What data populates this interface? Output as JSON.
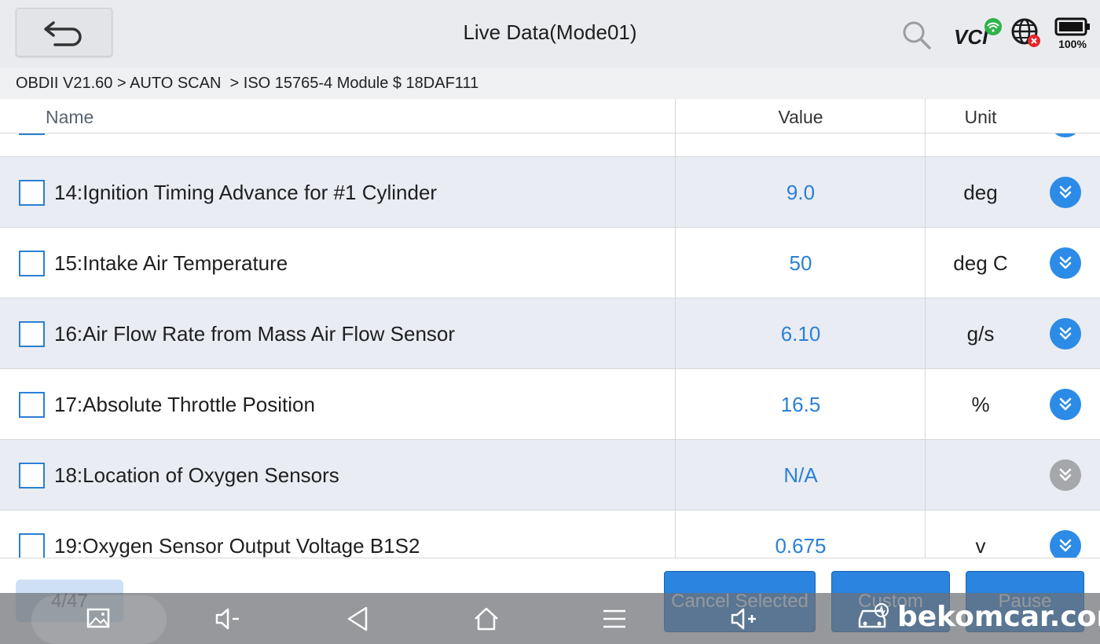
{
  "header": {
    "title": "Live Data(Mode01)",
    "battery_label": "100%",
    "vci_label": "VCI"
  },
  "breadcrumb": "OBDII V21.60 > AUTO SCAN  > ISO 15765-4 Module $ 18DAF111",
  "table": {
    "columns": {
      "name": "Name",
      "value": "Value",
      "unit": "Unit"
    },
    "rows": [
      {
        "name": "14:Ignition Timing Advance for #1 Cylinder",
        "value": "9.0",
        "unit": "deg",
        "expand_enabled": true
      },
      {
        "name": "15:Intake Air Temperature",
        "value": "50",
        "unit": "deg C",
        "expand_enabled": true
      },
      {
        "name": "16:Air Flow Rate from Mass Air Flow Sensor",
        "value": "6.10",
        "unit": "g/s",
        "expand_enabled": true
      },
      {
        "name": "17:Absolute Throttle Position",
        "value": "16.5",
        "unit": "%",
        "expand_enabled": true
      },
      {
        "name": "18:Location of Oxygen Sensors",
        "value": "N/A",
        "unit": "",
        "expand_enabled": false
      },
      {
        "name": "19:Oxygen Sensor Output Voltage B1S2",
        "value": "0.675",
        "unit": "v",
        "expand_enabled": true
      }
    ]
  },
  "footer": {
    "page_indicator": "4/47",
    "cancel_selected_label": "Cancel Selected",
    "custom_label": "Custom",
    "pause_label": "Pause"
  },
  "watermark": "bekomcar.com",
  "colors": {
    "accent": "#2c8be6",
    "value_text": "#2b80d8",
    "row_alt": "#e9ecf2",
    "disabled": "#a5a7aa"
  },
  "icons": {
    "back": "back-arrow-icon",
    "search": "search-icon",
    "vci": "vci-wifi-icon",
    "globe": "globe-error-icon",
    "battery": "battery-icon",
    "expand": "double-chevron-down-icon"
  }
}
